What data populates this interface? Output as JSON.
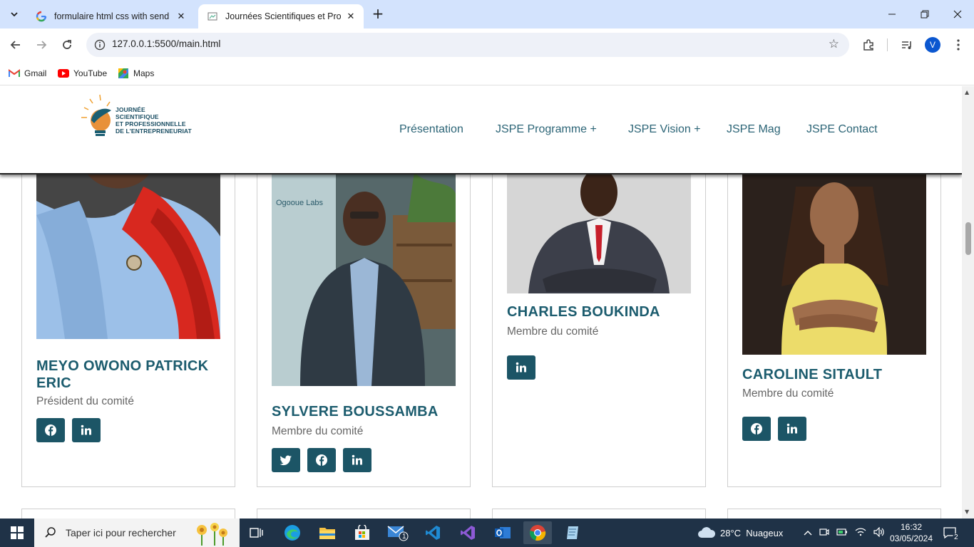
{
  "browser": {
    "tabs": [
      {
        "title": "formulaire html css with send e",
        "favicon": "google-icon",
        "active": false
      },
      {
        "title": "Journées Scientifiques et Profes",
        "favicon": "page-icon",
        "active": true
      }
    ],
    "url": "127.0.0.1:5500/main.html",
    "profile_initial": "V",
    "bookmarks": [
      {
        "label": "Gmail",
        "icon": "gmail-icon"
      },
      {
        "label": "YouTube",
        "icon": "youtube-icon"
      },
      {
        "label": "Maps",
        "icon": "maps-icon"
      }
    ]
  },
  "site": {
    "logo_lines": [
      "JOURNÉE",
      "SCIENTIFIQUE",
      "ET PROFESSIONNELLE",
      "DE L'ENTREPRENEURIAT"
    ],
    "nav": [
      "Présentation",
      "JSPE Programme +",
      "JSPE Vision +",
      "JSPE Mag",
      "JSPE Contact"
    ],
    "brand_color": "#1c5566"
  },
  "members": [
    {
      "name": "MEYO OWONO PATRICK ERIC",
      "role": "Président du comité",
      "socials": [
        "facebook",
        "linkedin"
      ]
    },
    {
      "name": "SYLVERE BOUSSAMBA",
      "role": "Membre du comité",
      "socials": [
        "twitter",
        "facebook",
        "linkedin"
      ]
    },
    {
      "name": "CHARLES BOUKINDA",
      "role": "Membre du comité",
      "socials": [
        "linkedin"
      ]
    },
    {
      "name": "CAROLINE SITAULT",
      "role": "Membre du comité",
      "socials": [
        "facebook",
        "linkedin"
      ]
    }
  ],
  "taskbar": {
    "search_placeholder": "Taper ici pour rechercher",
    "weather": "28°C  Nuageux",
    "time": "16:32",
    "date": "03/05/2024",
    "notifications": "2",
    "mail_badge": "1"
  }
}
